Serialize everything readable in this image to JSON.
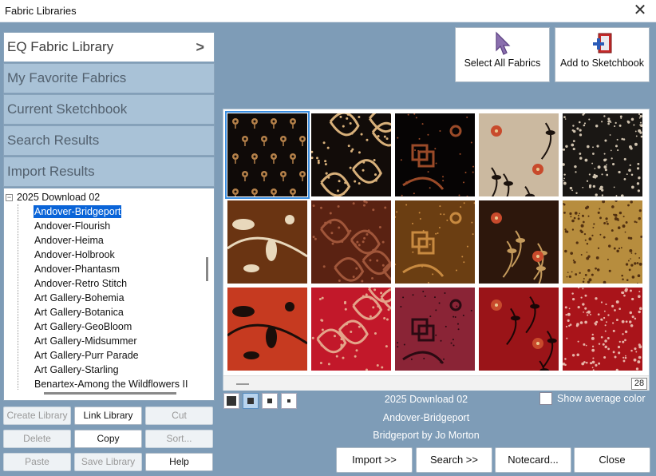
{
  "window": {
    "title": "Fabric Libraries",
    "close_glyph": "✕"
  },
  "libraries": [
    {
      "label": "EQ Fabric Library",
      "active": true
    },
    {
      "label": "My Favorite Fabrics",
      "active": false
    },
    {
      "label": "Current Sketchbook",
      "active": false
    },
    {
      "label": "Search Results",
      "active": false
    },
    {
      "label": "Import Results",
      "active": false
    }
  ],
  "library_chevron": ">",
  "tree": {
    "root": "2025 Download 02",
    "items": [
      "Andover-Bridgeport",
      "Andover-Flourish",
      "Andover-Heima",
      "Andover-Holbrook",
      "Andover-Phantasm",
      "Andover-Retro Stitch",
      "Art Gallery-Bohemia",
      "Art Gallery-Botanica",
      "Art Gallery-GeoBloom",
      "Art Gallery-Midsummer",
      "Art Gallery-Purr Parade",
      "Art Gallery-Starling",
      "Benartex-Among the Wildflowers II"
    ],
    "selected_index": 0
  },
  "side_buttons": [
    {
      "label": "Create Library",
      "enabled": false
    },
    {
      "label": "Link Library",
      "enabled": true
    },
    {
      "label": "Cut",
      "enabled": false
    },
    {
      "label": "Delete",
      "enabled": false
    },
    {
      "label": "Copy",
      "enabled": true
    },
    {
      "label": "Sort...",
      "enabled": false
    },
    {
      "label": "Paste",
      "enabled": false
    },
    {
      "label": "Save Library",
      "enabled": false
    },
    {
      "label": "Help",
      "enabled": true
    }
  ],
  "toolbar": {
    "select_all_label": "Select All Fabrics",
    "add_sketchbook_label": "Add to Sketchbook"
  },
  "fabrics": [
    {
      "bg": "#0f0a08",
      "fg": "#b5814a",
      "pattern": "dots"
    },
    {
      "bg": "#120c09",
      "fg": "#d8b07a",
      "pattern": "paisley"
    },
    {
      "bg": "#060404",
      "fg": "#9a4a28",
      "pattern": "knot"
    },
    {
      "bg": "#cbb9a0",
      "fg": "#1b120d",
      "pattern": "floral"
    },
    {
      "bg": "#1a1714",
      "fg": "#cfc2ae",
      "pattern": "speckle"
    },
    {
      "bg": "#6a3412",
      "fg": "#e8d8bc",
      "pattern": "bigfloral"
    },
    {
      "bg": "#5a2212",
      "fg": "#a0563a",
      "pattern": "paisley"
    },
    {
      "bg": "#6b3e12",
      "fg": "#c88a40",
      "pattern": "knot"
    },
    {
      "bg": "#2d170c",
      "fg": "#c49a5c",
      "pattern": "floral"
    },
    {
      "bg": "#b78d3e",
      "fg": "#523010",
      "pattern": "speckle"
    },
    {
      "bg": "#c63a20",
      "fg": "#1a0e0a",
      "pattern": "bigfloral"
    },
    {
      "bg": "#c2182a",
      "fg": "#e4a48a",
      "pattern": "paisley"
    },
    {
      "bg": "#8a2436",
      "fg": "#2a0a12",
      "pattern": "knot"
    },
    {
      "bg": "#9a1418",
      "fg": "#1a0606",
      "pattern": "floral"
    },
    {
      "bg": "#a9141a",
      "fg": "#e6b4a8",
      "pattern": "speckle"
    }
  ],
  "fabric_count": "28",
  "info": {
    "library": "2025 Download 02",
    "collection": "Andover-Bridgeport",
    "designer": "Bridgeport by Jo Morton"
  },
  "avg_color_label": "Show average color",
  "actions": {
    "import": "Import      >>",
    "search": "Search      >>",
    "notecard": "Notecard...",
    "close": "Close"
  }
}
